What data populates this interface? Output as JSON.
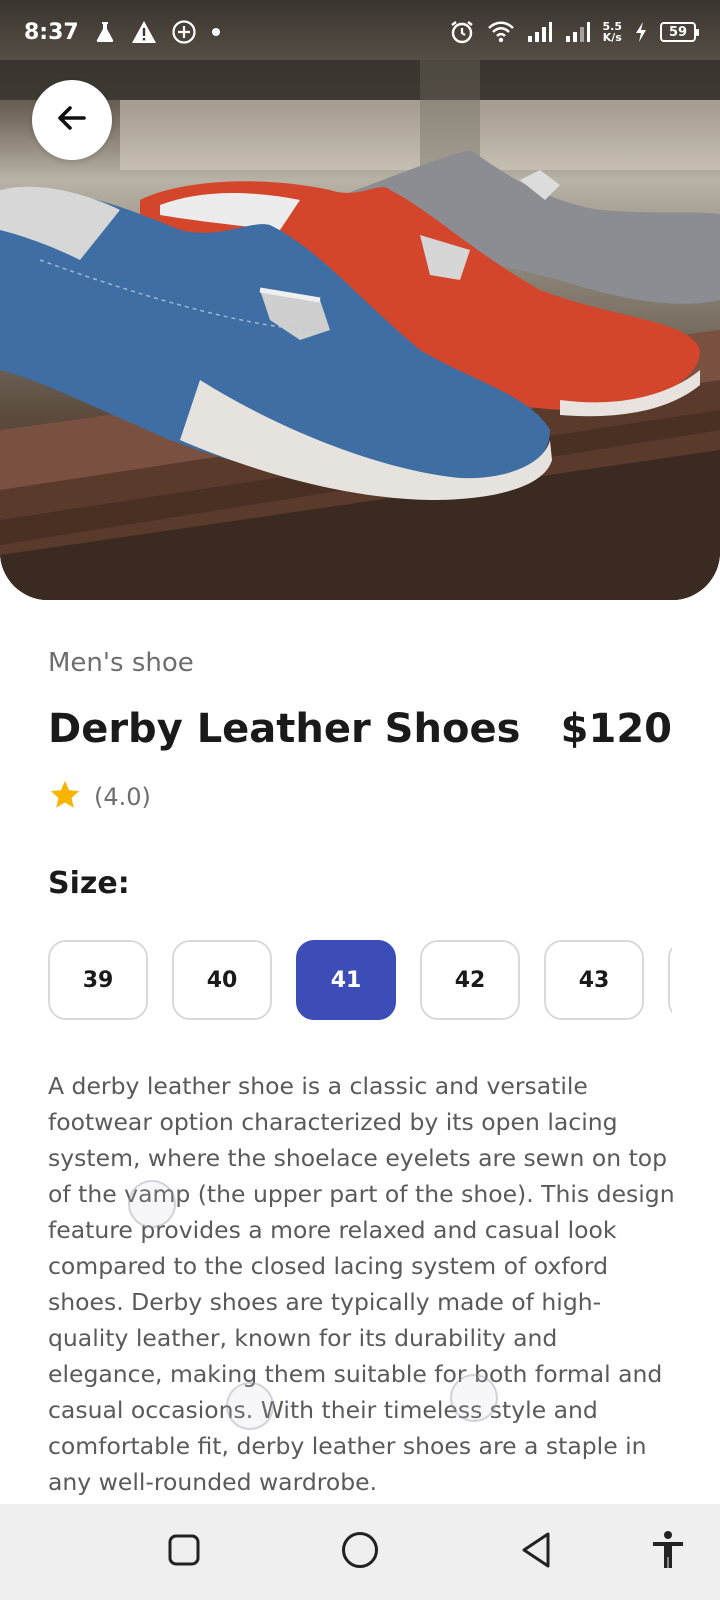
{
  "status_bar": {
    "time": "8:37",
    "net_speed_value": "5.5",
    "net_speed_unit": "K/s",
    "battery": "59",
    "left_icons": [
      "flask-icon",
      "warning-icon",
      "plus-circle-icon",
      "dot-icon"
    ],
    "right_icons": [
      "alarm-icon",
      "wifi-icon",
      "signal-icon",
      "signal-icon",
      "charging-icon",
      "battery-icon"
    ]
  },
  "header": {
    "back_icon": "arrow-left-icon"
  },
  "product": {
    "category": "Men's shoe",
    "title": "Derby Leather Shoes",
    "price": "$120",
    "rating_text": "(4.0)",
    "rating_value": 4.0,
    "rating_icon": "star-icon",
    "star_color": "#f7b500",
    "size_label": "Size:",
    "sizes": [
      {
        "label": "39",
        "selected": false
      },
      {
        "label": "40",
        "selected": false
      },
      {
        "label": "41",
        "selected": true
      },
      {
        "label": "42",
        "selected": false
      },
      {
        "label": "43",
        "selected": false
      }
    ],
    "accent_color": "#3d4db7",
    "description": "A derby leather shoe is a classic and versatile footwear option characterized by its open lacing system, where the shoelace eyelets are sewn on top of the vamp (the upper part of the shoe). This design feature provides a more relaxed and casual look compared to the closed lacing system of oxford shoes. Derby shoes are typically made of high-quality leather, known for its durability and elegance, making them suitable for both formal and casual occasions. With their timeless style and comfortable fit, derby leather shoes are a staple in any well-rounded wardrobe."
  },
  "navigation_bar": {
    "icons": [
      "recents-square-icon",
      "home-circle-icon",
      "back-triangle-icon",
      "accessibility-icon"
    ]
  }
}
